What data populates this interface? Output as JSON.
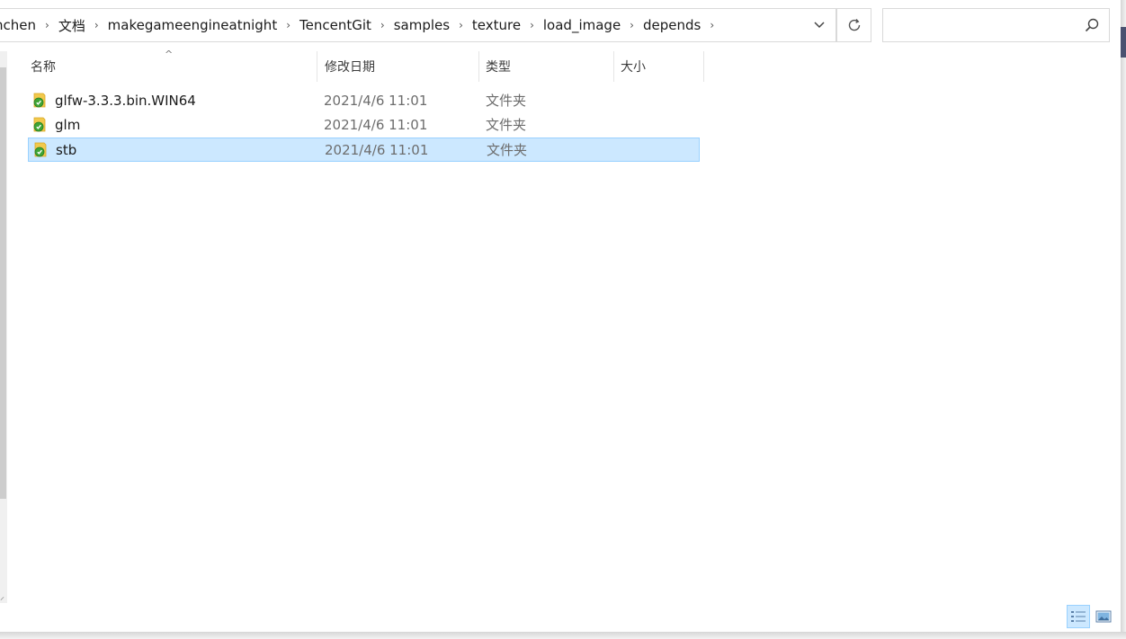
{
  "breadcrumb": [
    "nchen",
    "文档",
    "makegameengineatnight",
    "TencentGit",
    "samples",
    "texture",
    "load_image",
    "depends"
  ],
  "breadcrumb_separator": "›",
  "search": {
    "placeholder": ""
  },
  "columns": {
    "name": "名称",
    "date": "修改日期",
    "type": "类型",
    "size": "大小"
  },
  "files": [
    {
      "name": "glfw-3.3.3.bin.WIN64",
      "date": "2021/4/6 11:01",
      "type": "文件夹",
      "size": "",
      "selected": false
    },
    {
      "name": "glm",
      "date": "2021/4/6 11:01",
      "type": "文件夹",
      "size": "",
      "selected": false
    },
    {
      "name": "stb",
      "date": "2021/4/6 11:01",
      "type": "文件夹",
      "size": "",
      "selected": true
    }
  ],
  "icons": {
    "folder": "folder-sync-icon",
    "refresh": "refresh-icon",
    "search": "search-icon",
    "dropdown": "chevron-down-icon",
    "details_view": "details-view-icon",
    "large_icons_view": "large-icons-view-icon"
  },
  "colors": {
    "selection_bg": "#cce8ff",
    "selection_border": "#99d1ff",
    "folder_yellow": "#f2c94c",
    "sync_green": "#3fa535"
  }
}
